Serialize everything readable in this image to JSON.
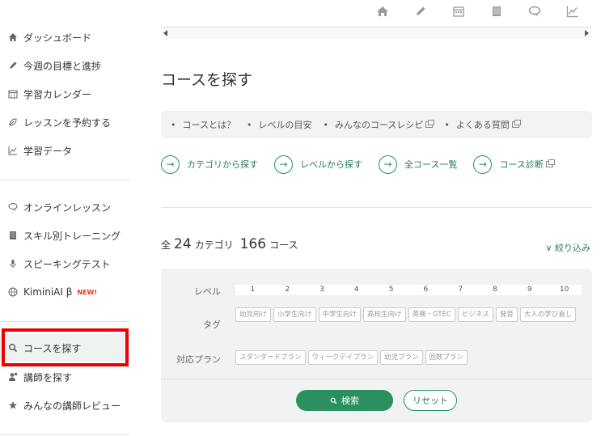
{
  "sidebar": {
    "items": [
      {
        "label": "ダッシュボード",
        "icon": "home-icon"
      },
      {
        "label": "今週の目標と進捗",
        "icon": "pencil-icon"
      },
      {
        "label": "学習カレンダー",
        "icon": "calendar-icon"
      },
      {
        "label": "レッスンを予約する",
        "icon": "leaf-icon"
      },
      {
        "label": "学習データ",
        "icon": "chart-icon"
      },
      {
        "label": "オンラインレッスン",
        "icon": "chat-icon"
      },
      {
        "label": "スキル別トレーニング",
        "icon": "book-icon"
      },
      {
        "label": "スピーキングテスト",
        "icon": "mic-icon"
      },
      {
        "label": "KiminiAI β",
        "icon": "globe-icon",
        "badge": "NEW!"
      },
      {
        "label": "コースを探す",
        "icon": "search-icon"
      },
      {
        "label": "講師を探す",
        "icon": "teacher-icon"
      },
      {
        "label": "みんなの講師レビュー",
        "icon": "star-icon"
      }
    ]
  },
  "page": {
    "title": "コースを探す",
    "links": [
      {
        "label": "コースとは？",
        "external": false
      },
      {
        "label": "レベルの目安",
        "external": false
      },
      {
        "label": "みんなのコースレシピ",
        "external": true
      },
      {
        "label": "よくある質問",
        "external": true
      }
    ],
    "ctas": [
      {
        "label": "カテゴリから探す",
        "external": false
      },
      {
        "label": "レベルから探す",
        "external": false
      },
      {
        "label": "全コース一覧",
        "external": false
      },
      {
        "label": "コース診断",
        "external": true
      }
    ],
    "count_prefix": "全",
    "category_count": "24",
    "category_unit": "カテゴリ",
    "course_count": "166",
    "course_unit": "コース",
    "narrow_label": "絞り込み"
  },
  "filter": {
    "level_label": "レベル",
    "levels": [
      "1",
      "2",
      "3",
      "4",
      "5",
      "6",
      "7",
      "8",
      "9",
      "10"
    ],
    "tag_label": "タグ",
    "tags": [
      "幼児向け",
      "小学生向け",
      "中学生向け",
      "高校生向け",
      "英検・GTEC",
      "ビジネス",
      "発音",
      "大人の学び直し"
    ],
    "plan_label": "対応プラン",
    "plans": [
      "スタンダードプラン",
      "ウィークデイプラン",
      "幼児プラン",
      "回数プラン"
    ],
    "search_label": "検索",
    "reset_label": "リセット"
  },
  "colors": {
    "accent": "#2a9060",
    "highlight": "#e00000"
  }
}
